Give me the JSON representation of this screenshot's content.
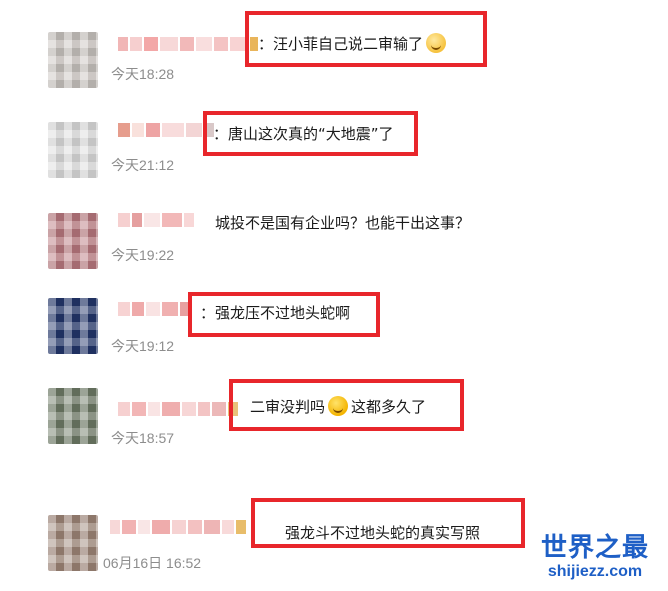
{
  "comments": [
    {
      "text": "：汪小菲自己说二审输了",
      "emoji": "laughing-crying-emoji",
      "time": "今天18:28",
      "highlighted": true
    },
    {
      "text": "：唐山这次真的“大地震”了",
      "time": "今天21:12",
      "highlighted": true
    },
    {
      "text": "城投不是国有企业吗？也能干出这事？",
      "time": "今天19:22",
      "highlighted": false
    },
    {
      "text": "：强龙压不过地头蛇啊",
      "time": "今天19:12",
      "highlighted": true
    },
    {
      "text_before": "二审没判吗",
      "emoji": "smirk-emoji",
      "text_after": "这都多久了",
      "time": "今天18:57",
      "highlighted": true
    },
    {
      "text": "强龙斗不过地头蛇的真实写照",
      "time": "06月16日 16:52",
      "highlighted": true
    }
  ],
  "watermark": {
    "title": "世界之最",
    "url": "shijiezz.com"
  },
  "colors": {
    "highlight": "#e8262b",
    "timestamp": "#8d8d8d",
    "watermark": "#1e5fc6"
  }
}
